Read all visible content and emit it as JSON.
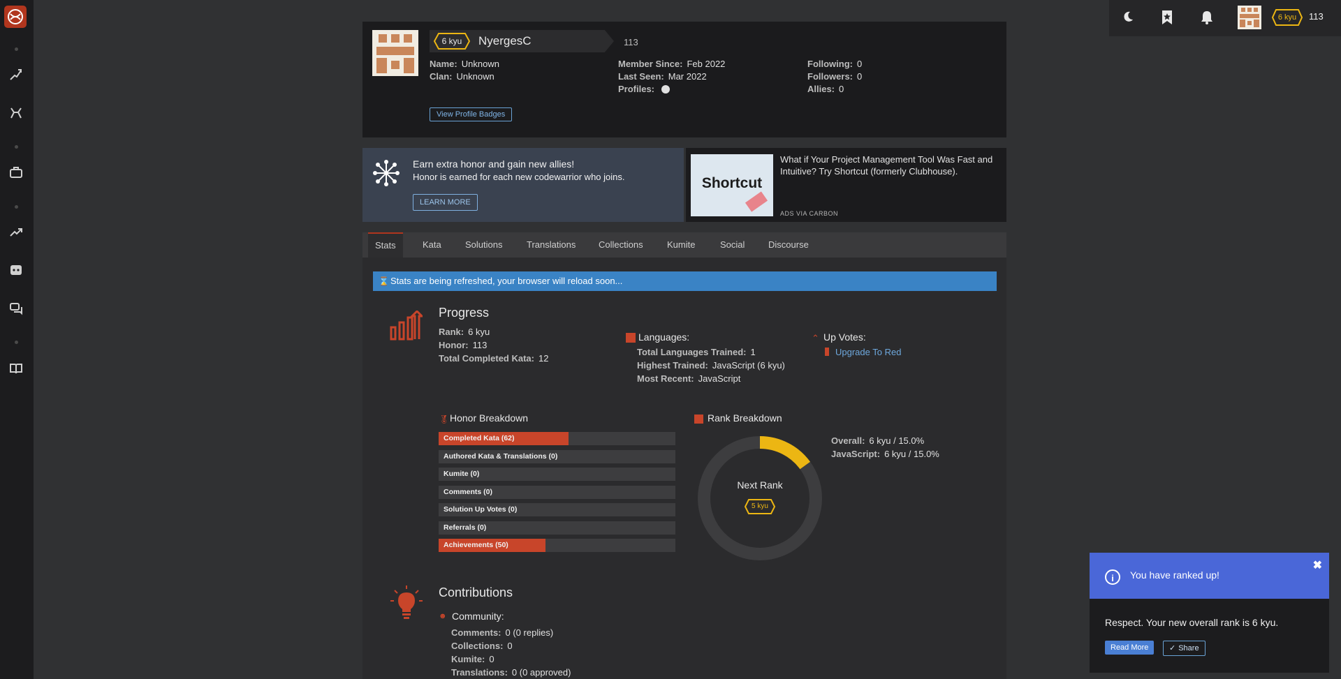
{
  "sidebar": {
    "items": [
      "logo-icon",
      "training-icon",
      "practice-icon",
      "briefcase-icon",
      "trending-icon",
      "discord-icon",
      "forum-icon",
      "docs-icon"
    ]
  },
  "topbar": {
    "rank": "6 kyu",
    "honor": "113"
  },
  "profile": {
    "rank": "6 kyu",
    "username": "NyergesC",
    "honor": "113",
    "name_label": "Name:",
    "name_value": "Unknown",
    "clan_label": "Clan:",
    "clan_value": "Unknown",
    "member_since_label": "Member Since:",
    "member_since_value": "Feb 2022",
    "last_seen_label": "Last Seen:",
    "last_seen_value": "Mar 2022",
    "profiles_label": "Profiles:",
    "following_label": "Following:",
    "following_value": "0",
    "followers_label": "Followers:",
    "followers_value": "0",
    "allies_label": "Allies:",
    "allies_value": "0",
    "badges_button": "View Profile Badges"
  },
  "promo": {
    "title": "Earn extra honor and gain new allies!",
    "subtitle": "Honor is earned for each new codewarrior who joins.",
    "button": "LEARN MORE"
  },
  "ad": {
    "logo_text": "Shortcut",
    "text": "What if Your Project Management Tool Was Fast and Intuitive? Try Shortcut (formerly Clubhouse).",
    "via": "ADS VIA CARBON"
  },
  "tabs": [
    "Stats",
    "Kata",
    "Solutions",
    "Translations",
    "Collections",
    "Kumite",
    "Social",
    "Discourse"
  ],
  "alert": "Stats are being refreshed, your browser will reload soon...",
  "progress": {
    "title": "Progress",
    "rank_label": "Rank:",
    "rank_value": "6 kyu",
    "honor_label": "Honor:",
    "honor_value": "113",
    "completed_label": "Total Completed Kata:",
    "completed_value": "12",
    "languages_title": "Languages:",
    "total_lang_label": "Total Languages Trained:",
    "total_lang_value": "1",
    "highest_label": "Highest Trained:",
    "highest_value": "JavaScript (6 kyu)",
    "recent_label": "Most Recent:",
    "recent_value": "JavaScript",
    "upvotes_title": "Up Votes:",
    "upgrade_link": "Upgrade To Red"
  },
  "honor_breakdown": {
    "title": "Honor Breakdown",
    "bars": [
      {
        "label": "Completed Kata (62)",
        "fill": 0.55
      },
      {
        "label": "Authored Kata & Translations (0)",
        "fill": 0
      },
      {
        "label": "Kumite (0)",
        "fill": 0
      },
      {
        "label": "Comments (0)",
        "fill": 0
      },
      {
        "label": "Solution Up Votes (0)",
        "fill": 0
      },
      {
        "label": "Referrals (0)",
        "fill": 0
      },
      {
        "label": "Achievements (50)",
        "fill": 0.45
      }
    ]
  },
  "rank_breakdown": {
    "title": "Rank Breakdown",
    "next_rank_label": "Next Rank",
    "next_rank": "5 kyu",
    "progress": 0.15,
    "overall_label": "Overall:",
    "overall_value": "6 kyu / 15.0%",
    "js_label": "JavaScript:",
    "js_value": "6 kyu / 15.0%"
  },
  "contributions": {
    "title": "Contributions",
    "community_label": "Community:",
    "comments_label": "Comments:",
    "comments_value": "0 (0 replies)",
    "collections_label": "Collections:",
    "collections_value": "0",
    "kumite_label": "Kumite:",
    "kumite_value": "0",
    "translations_label": "Translations:",
    "translations_value": "0 (0 approved)"
  },
  "toast": {
    "title": "You have ranked up!",
    "body": "Respect. Your new overall rank is 6 kyu.",
    "read_more": "Read More",
    "share": "Share"
  },
  "colors": {
    "accent": "#b1361e",
    "rank_yellow": "#ecb613",
    "alert_blue": "#3a83c5",
    "toast_blue": "#4a67d8"
  }
}
